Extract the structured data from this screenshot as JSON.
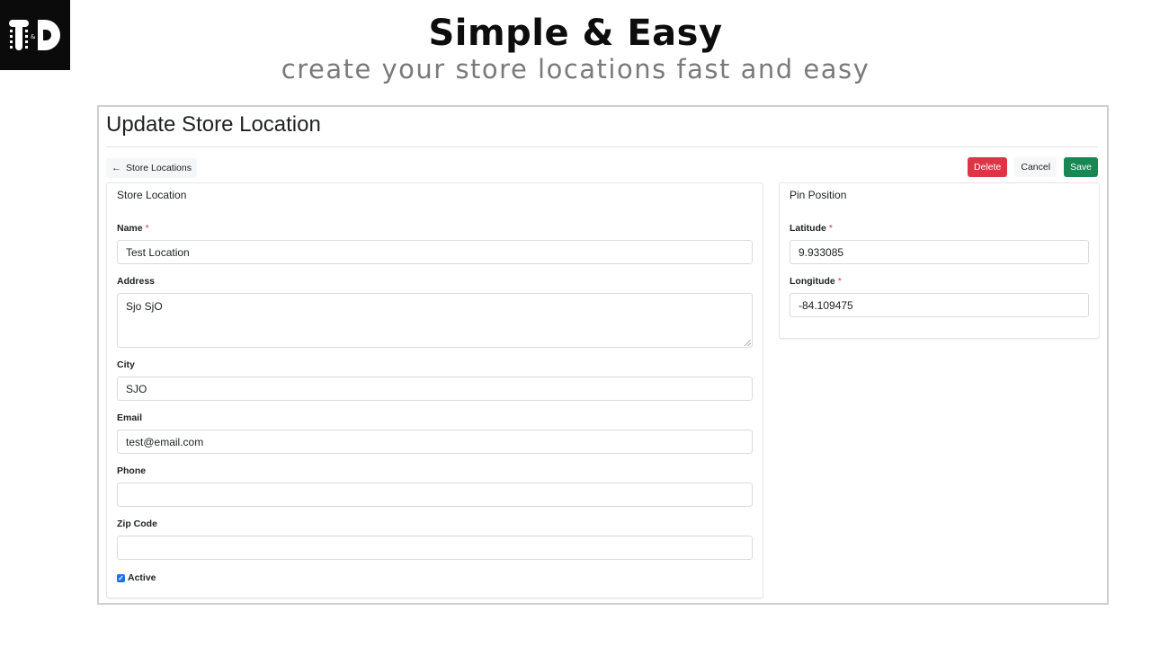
{
  "brand": {
    "logo_text": "T&D",
    "logo_icon": "td-logo-icon"
  },
  "hero": {
    "title": "Simple & Easy",
    "subtitle": "create your store locations fast and easy"
  },
  "page": {
    "title": "Update Store Location",
    "back_label": "Store Locations",
    "back_icon": "arrow-left-icon"
  },
  "actions": {
    "delete_label": "Delete",
    "cancel_label": "Cancel",
    "save_label": "Save",
    "colors": {
      "delete": "#dc3545",
      "save": "#198754"
    }
  },
  "store_location": {
    "title": "Store Location",
    "fields": {
      "name": {
        "label": "Name",
        "required": "*",
        "value": "Test Location"
      },
      "address": {
        "label": "Address",
        "value": "Sjo SjO"
      },
      "city": {
        "label": "City",
        "value": "SJO"
      },
      "email": {
        "label": "Email",
        "value": "test@email.com"
      },
      "phone": {
        "label": "Phone",
        "value": ""
      },
      "zip": {
        "label": "Zip Code",
        "value": ""
      }
    },
    "active": {
      "label": "Active",
      "checked": true
    }
  },
  "pin_position": {
    "title": "Pin Position",
    "latitude": {
      "label": "Latitude",
      "required": "*",
      "value": "9.933085"
    },
    "longitude": {
      "label": "Longitude",
      "required": "*",
      "value": "-84.109475"
    }
  }
}
